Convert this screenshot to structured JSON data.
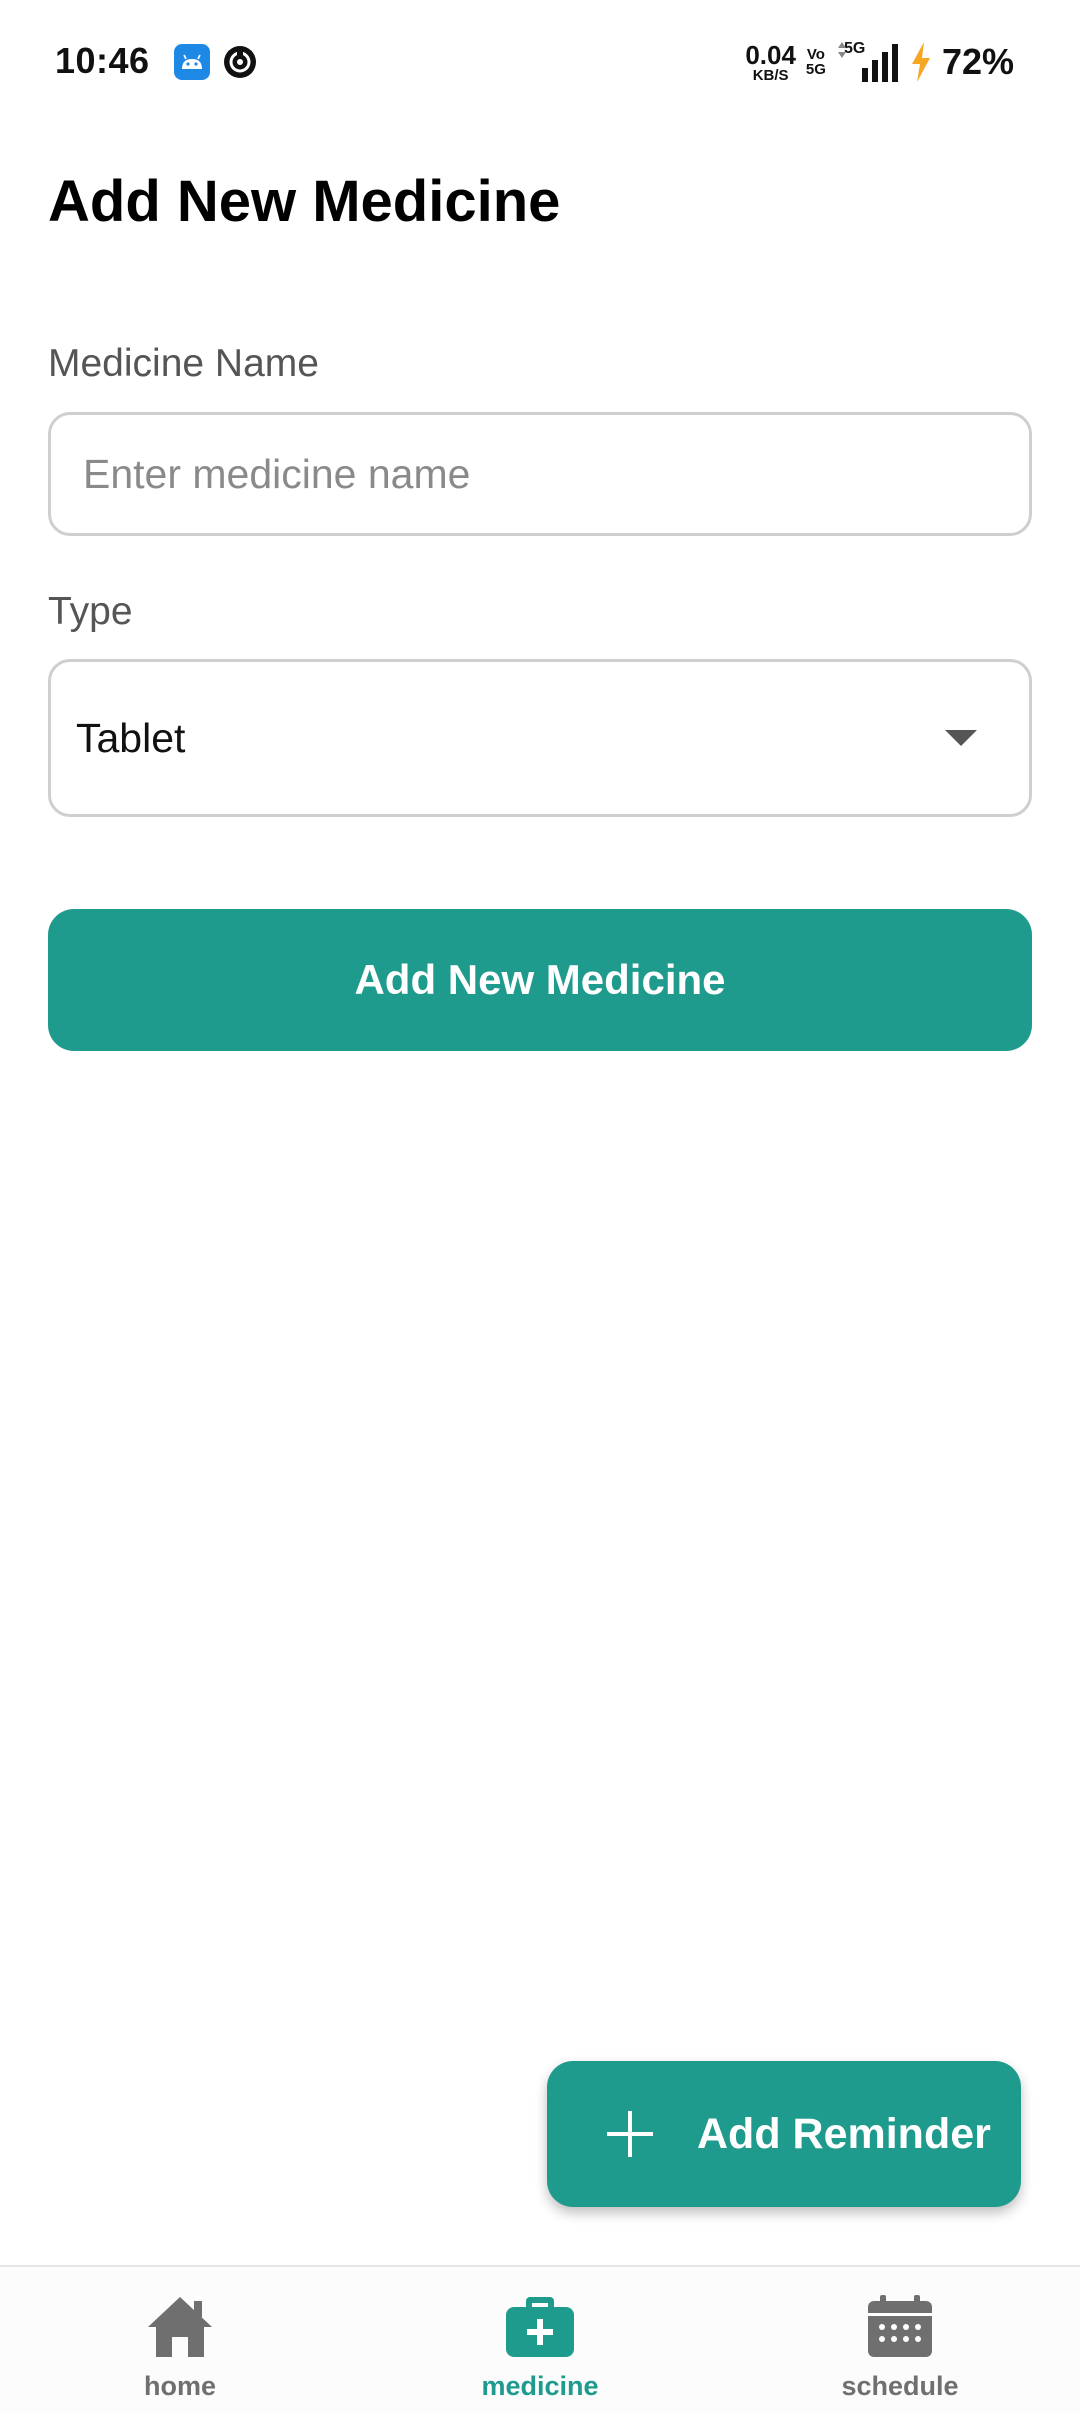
{
  "status_bar": {
    "time": "10:46",
    "net_speed_value": "0.04",
    "net_speed_unit": "KB/S",
    "volte_top": "Vo",
    "volte_bottom": "5G",
    "network": "5G",
    "battery": "72%"
  },
  "page": {
    "title": "Add New Medicine"
  },
  "form": {
    "name_label": "Medicine Name",
    "name_placeholder": "Enter medicine name",
    "name_value": "",
    "type_label": "Type",
    "type_value": "Tablet",
    "submit_label": "Add New Medicine"
  },
  "fab": {
    "label": "Add Reminder",
    "icon": "plus-icon"
  },
  "bottom_nav": {
    "items": [
      {
        "label": "home",
        "icon": "home-icon",
        "active": false
      },
      {
        "label": "medicine",
        "icon": "medical-kit-icon",
        "active": true
      },
      {
        "label": "schedule",
        "icon": "calendar-icon",
        "active": false
      }
    ]
  },
  "colors": {
    "accent": "#1e9b8d",
    "nav_inactive": "#6f6f6f",
    "border": "#cfcfcf"
  }
}
